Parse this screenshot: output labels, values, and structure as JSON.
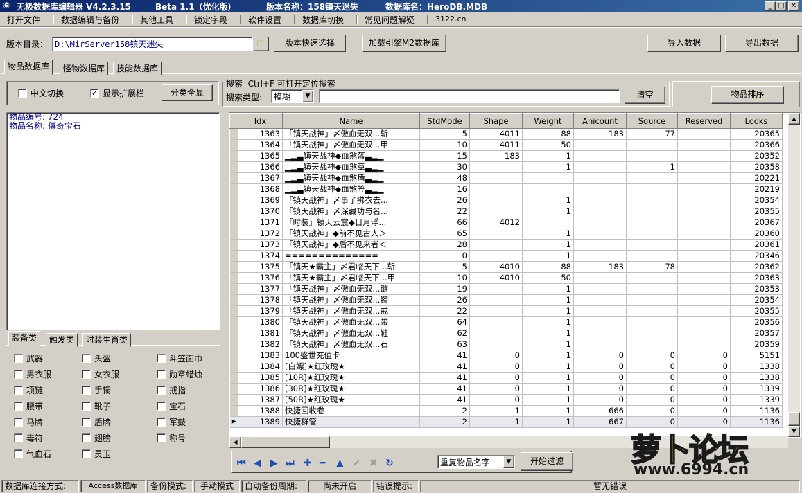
{
  "titlebar": {
    "app_title": "无极数据库编辑器 V4.2.3.15",
    "beta": "Beta 1.1（优化版）",
    "version_name": "版本名称：158镇天迷失",
    "db_name": "数据库名：HeroDB.MDB"
  },
  "menu": [
    "打开文件",
    "数据编辑与备份",
    "其他工具",
    "锁定字段",
    "软件设置",
    "数据库切换",
    "常见问题解疑",
    "3122.cn"
  ],
  "toolbar": {
    "version_dir_label": "版本目录：",
    "version_dir_value": "D:\\MirServer158镇天迷失",
    "quick_select": "版本快速选择",
    "load_engine": "加载引擎M2数据库",
    "import": "导入数据",
    "export": "导出数据"
  },
  "tabs": [
    "物品数据库",
    "怪物数据库",
    "技能数据库"
  ],
  "options": {
    "chinese_toggle": "中文切换",
    "show_ext": "显示扩展栏",
    "show_all_categories": "分类全显"
  },
  "search": {
    "title": "搜索  Ctrl+F 可打开定位搜索",
    "type_label": "搜索类型:",
    "type_value": "模糊",
    "clear": "清空",
    "sort": "物品排序"
  },
  "item_info": {
    "id_line": "物品编号: 724",
    "name_line": "物品名称: 傳奇宝石"
  },
  "category_tabs": [
    "装备类",
    "触发类",
    "时装生肖类"
  ],
  "categories": [
    [
      "武器",
      "头盔",
      "斗笠面巾"
    ],
    [
      "男衣服",
      "女衣服",
      "勋章蜡烛"
    ],
    [
      "项链",
      "手镯",
      "戒指"
    ],
    [
      "腰带",
      "靴子",
      "宝石"
    ],
    [
      "马牌",
      "盾牌",
      "军鼓"
    ],
    [
      "毒符",
      "翅膀",
      "称号"
    ],
    [
      "气血石",
      "灵玉",
      ""
    ]
  ],
  "grid": {
    "columns": [
      "Idx",
      "Name",
      "StdMode",
      "Shape",
      "Weight",
      "Anicount",
      "Source",
      "Reserved",
      "Looks"
    ],
    "rows": [
      [
        "1363",
        "「镇天战神」〆傲血无双...斩",
        "5",
        "4011",
        "88",
        "183",
        "77",
        "",
        "20365"
      ],
      [
        "1364",
        "「镇天战神」〆傲血无双...甲",
        "10",
        "4011",
        "50",
        "",
        "",
        "",
        "20366"
      ],
      [
        "1365",
        "▁▂▃镇天战神◆血煞盔▃▂▁",
        "15",
        "183",
        "1",
        "",
        "",
        "",
        "20352"
      ],
      [
        "1366",
        "▁▂▃镇天战神◆血煞章▃▂▁",
        "30",
        "",
        "1",
        "",
        "1",
        "",
        "20358"
      ],
      [
        "1367",
        "▁▂▃镇天战神◆血煞盾▃▂▁",
        "48",
        "",
        "",
        "",
        "",
        "",
        "20221"
      ],
      [
        "1368",
        "▁▂▃镇天战神◆血煞笠▃▂▁",
        "16",
        "",
        "",
        "",
        "",
        "",
        "20219"
      ],
      [
        "1369",
        "「镇天战神」〆事了拂衣去...",
        "26",
        "",
        "1",
        "",
        "",
        "",
        "20354"
      ],
      [
        "1370",
        "「镇天战神」〆深藏功与名...",
        "22",
        "",
        "1",
        "",
        "",
        "",
        "20355"
      ],
      [
        "1371",
        "「时装」镇天云震◆日月浮...",
        "66",
        "4012",
        "",
        "",
        "",
        "",
        "20367"
      ],
      [
        "1372",
        "「镇天战神」◆前不见古人＞",
        "65",
        "",
        "1",
        "",
        "",
        "",
        "20360"
      ],
      [
        "1373",
        "「镇天战神」◆后不见来者＜",
        "28",
        "",
        "1",
        "",
        "",
        "",
        "20361"
      ],
      [
        "1374",
        "==============",
        "0",
        "",
        "1",
        "",
        "",
        "",
        "20346"
      ],
      [
        "1375",
        "「镇天★霸主」〆君临天下...斩",
        "5",
        "4010",
        "88",
        "183",
        "78",
        "",
        "20362"
      ],
      [
        "1376",
        "「镇天★霸主」〆君临天下...甲",
        "10",
        "4010",
        "50",
        "",
        "",
        "",
        "20363"
      ],
      [
        "1377",
        "「镇天战神」〆傲血无双...链",
        "19",
        "",
        "1",
        "",
        "",
        "",
        "20353"
      ],
      [
        "1378",
        "「镇天战神」〆傲血无双...镯",
        "26",
        "",
        "1",
        "",
        "",
        "",
        "20354"
      ],
      [
        "1379",
        "「镇天战神」〆傲血无双...戒",
        "22",
        "",
        "1",
        "",
        "",
        "",
        "20355"
      ],
      [
        "1380",
        "「镇天战神」〆傲血无双...带",
        "64",
        "",
        "1",
        "",
        "",
        "",
        "20356"
      ],
      [
        "1381",
        "「镇天战神」〆傲血无双...鞋",
        "62",
        "",
        "1",
        "",
        "",
        "",
        "20357"
      ],
      [
        "1382",
        "「镇天战神」〆傲血无双...石",
        "63",
        "",
        "1",
        "",
        "",
        "",
        "20359"
      ],
      [
        "1383",
        "100盛世充值卡",
        "41",
        "0",
        "1",
        "0",
        "0",
        "0",
        "5151"
      ],
      [
        "1384",
        "[白嫖]★红玫瑰★",
        "41",
        "0",
        "1",
        "0",
        "0",
        "0",
        "1338"
      ],
      [
        "1385",
        "[10R]★红玫瑰★",
        "41",
        "0",
        "1",
        "0",
        "0",
        "0",
        "1338"
      ],
      [
        "1386",
        "[30R]★红玫瑰★",
        "41",
        "0",
        "1",
        "0",
        "0",
        "0",
        "1339"
      ],
      [
        "1387",
        "[50R]★红玫瑰★",
        "41",
        "0",
        "1",
        "0",
        "0",
        "0",
        "1339"
      ],
      [
        "1388",
        "快捷回收卷",
        "2",
        "1",
        "1",
        "666",
        "0",
        "0",
        "1136"
      ],
      [
        "1389",
        "快捷群管",
        "2",
        "1",
        "1",
        "667",
        "0",
        "0",
        "1136"
      ]
    ],
    "selected_index": 26
  },
  "bottom": {
    "dup_select": "重复物品名字",
    "filter": "开始过滤"
  },
  "watermark": {
    "brand": "萝卜论坛",
    "url": "www.6994.cn"
  },
  "status": {
    "conn_label": "数据库连接方式:",
    "conn_value": "Access数据库",
    "backup_label": "备份模式:",
    "backup_value": "手动模式",
    "auto_label": "自动备份周期:",
    "auto_value": "尚未开启",
    "err_label": "错误提示:",
    "err_value": "暂无错误"
  }
}
